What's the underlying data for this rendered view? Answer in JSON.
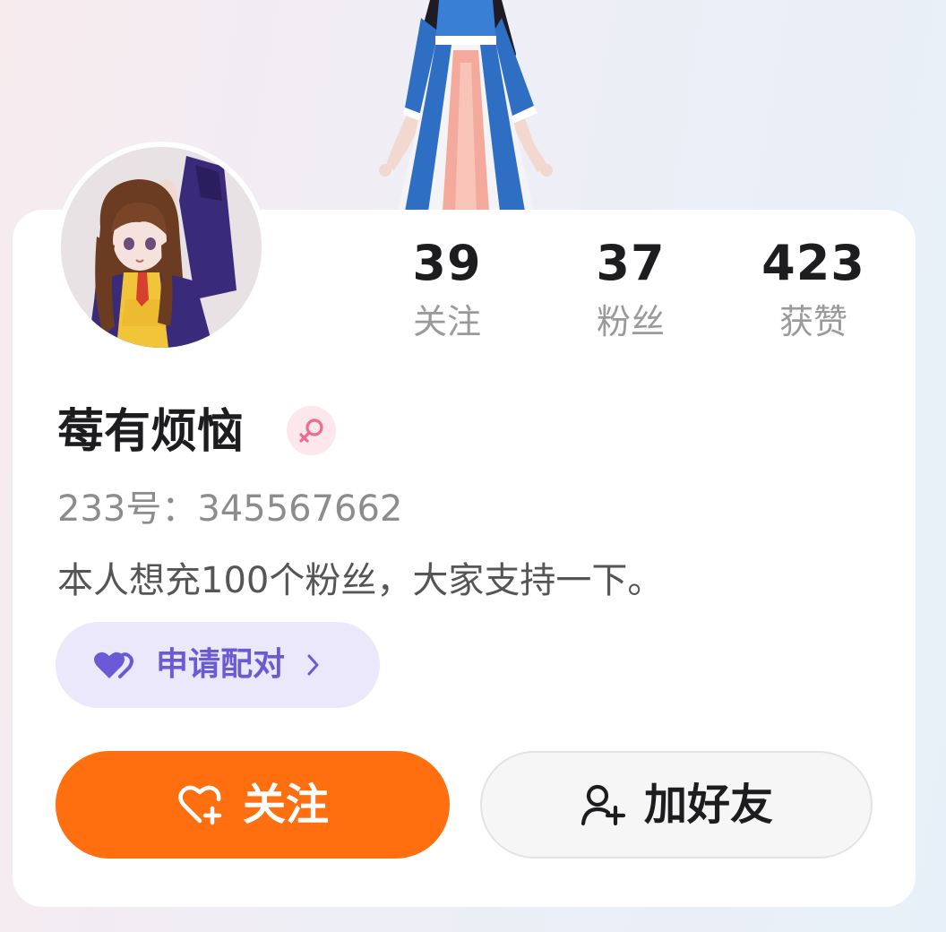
{
  "profile": {
    "name": "莓有烦恼",
    "gender_icon": "female-icon",
    "uid_text": "233号：345567662",
    "bio": "本人想充100个粉丝，大家支持一下。"
  },
  "stats": [
    {
      "value": "39",
      "label": "关注"
    },
    {
      "value": "37",
      "label": "粉丝"
    },
    {
      "value": "423",
      "label": "获赞"
    }
  ],
  "pair_chip": {
    "label": "申请配对",
    "icon": "double-heart-icon"
  },
  "actions": {
    "follow_label": "关注",
    "follow_icon": "heart-plus-icon",
    "add_friend_label": "加好友",
    "add_friend_icon": "user-plus-icon"
  },
  "colors": {
    "accent_orange": "#ff6f0f",
    "pair_purple": "#6a5ad6",
    "pair_bg": "#ebe8fb",
    "gender_pink": "#f06a8e"
  }
}
